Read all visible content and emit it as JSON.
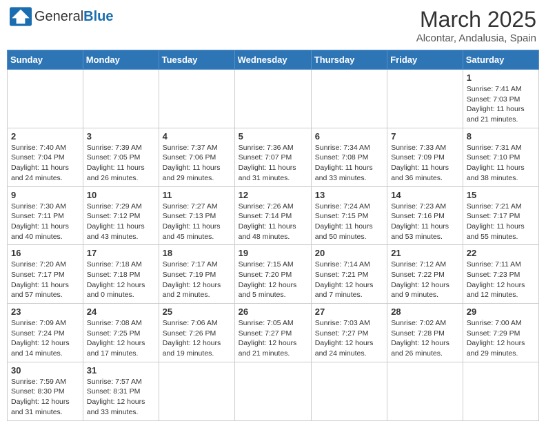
{
  "header": {
    "logo_text_normal": "General",
    "logo_text_bold": "Blue",
    "month_title": "March 2025",
    "subtitle": "Alcontar, Andalusia, Spain"
  },
  "weekdays": [
    "Sunday",
    "Monday",
    "Tuesday",
    "Wednesday",
    "Thursday",
    "Friday",
    "Saturday"
  ],
  "days": {
    "d1": {
      "num": "1",
      "info": "Sunrise: 7:41 AM\nSunset: 7:03 PM\nDaylight: 11 hours\nand 21 minutes."
    },
    "d2": {
      "num": "2",
      "info": "Sunrise: 7:40 AM\nSunset: 7:04 PM\nDaylight: 11 hours\nand 24 minutes."
    },
    "d3": {
      "num": "3",
      "info": "Sunrise: 7:39 AM\nSunset: 7:05 PM\nDaylight: 11 hours\nand 26 minutes."
    },
    "d4": {
      "num": "4",
      "info": "Sunrise: 7:37 AM\nSunset: 7:06 PM\nDaylight: 11 hours\nand 29 minutes."
    },
    "d5": {
      "num": "5",
      "info": "Sunrise: 7:36 AM\nSunset: 7:07 PM\nDaylight: 11 hours\nand 31 minutes."
    },
    "d6": {
      "num": "6",
      "info": "Sunrise: 7:34 AM\nSunset: 7:08 PM\nDaylight: 11 hours\nand 33 minutes."
    },
    "d7": {
      "num": "7",
      "info": "Sunrise: 7:33 AM\nSunset: 7:09 PM\nDaylight: 11 hours\nand 36 minutes."
    },
    "d8": {
      "num": "8",
      "info": "Sunrise: 7:31 AM\nSunset: 7:10 PM\nDaylight: 11 hours\nand 38 minutes."
    },
    "d9": {
      "num": "9",
      "info": "Sunrise: 7:30 AM\nSunset: 7:11 PM\nDaylight: 11 hours\nand 40 minutes."
    },
    "d10": {
      "num": "10",
      "info": "Sunrise: 7:29 AM\nSunset: 7:12 PM\nDaylight: 11 hours\nand 43 minutes."
    },
    "d11": {
      "num": "11",
      "info": "Sunrise: 7:27 AM\nSunset: 7:13 PM\nDaylight: 11 hours\nand 45 minutes."
    },
    "d12": {
      "num": "12",
      "info": "Sunrise: 7:26 AM\nSunset: 7:14 PM\nDaylight: 11 hours\nand 48 minutes."
    },
    "d13": {
      "num": "13",
      "info": "Sunrise: 7:24 AM\nSunset: 7:15 PM\nDaylight: 11 hours\nand 50 minutes."
    },
    "d14": {
      "num": "14",
      "info": "Sunrise: 7:23 AM\nSunset: 7:16 PM\nDaylight: 11 hours\nand 53 minutes."
    },
    "d15": {
      "num": "15",
      "info": "Sunrise: 7:21 AM\nSunset: 7:17 PM\nDaylight: 11 hours\nand 55 minutes."
    },
    "d16": {
      "num": "16",
      "info": "Sunrise: 7:20 AM\nSunset: 7:17 PM\nDaylight: 11 hours\nand 57 minutes."
    },
    "d17": {
      "num": "17",
      "info": "Sunrise: 7:18 AM\nSunset: 7:18 PM\nDaylight: 12 hours\nand 0 minutes."
    },
    "d18": {
      "num": "18",
      "info": "Sunrise: 7:17 AM\nSunset: 7:19 PM\nDaylight: 12 hours\nand 2 minutes."
    },
    "d19": {
      "num": "19",
      "info": "Sunrise: 7:15 AM\nSunset: 7:20 PM\nDaylight: 12 hours\nand 5 minutes."
    },
    "d20": {
      "num": "20",
      "info": "Sunrise: 7:14 AM\nSunset: 7:21 PM\nDaylight: 12 hours\nand 7 minutes."
    },
    "d21": {
      "num": "21",
      "info": "Sunrise: 7:12 AM\nSunset: 7:22 PM\nDaylight: 12 hours\nand 9 minutes."
    },
    "d22": {
      "num": "22",
      "info": "Sunrise: 7:11 AM\nSunset: 7:23 PM\nDaylight: 12 hours\nand 12 minutes."
    },
    "d23": {
      "num": "23",
      "info": "Sunrise: 7:09 AM\nSunset: 7:24 PM\nDaylight: 12 hours\nand 14 minutes."
    },
    "d24": {
      "num": "24",
      "info": "Sunrise: 7:08 AM\nSunset: 7:25 PM\nDaylight: 12 hours\nand 17 minutes."
    },
    "d25": {
      "num": "25",
      "info": "Sunrise: 7:06 AM\nSunset: 7:26 PM\nDaylight: 12 hours\nand 19 minutes."
    },
    "d26": {
      "num": "26",
      "info": "Sunrise: 7:05 AM\nSunset: 7:27 PM\nDaylight: 12 hours\nand 21 minutes."
    },
    "d27": {
      "num": "27",
      "info": "Sunrise: 7:03 AM\nSunset: 7:27 PM\nDaylight: 12 hours\nand 24 minutes."
    },
    "d28": {
      "num": "28",
      "info": "Sunrise: 7:02 AM\nSunset: 7:28 PM\nDaylight: 12 hours\nand 26 minutes."
    },
    "d29": {
      "num": "29",
      "info": "Sunrise: 7:00 AM\nSunset: 7:29 PM\nDaylight: 12 hours\nand 29 minutes."
    },
    "d30": {
      "num": "30",
      "info": "Sunrise: 7:59 AM\nSunset: 8:30 PM\nDaylight: 12 hours\nand 31 minutes."
    },
    "d31": {
      "num": "31",
      "info": "Sunrise: 7:57 AM\nSunset: 8:31 PM\nDaylight: 12 hours\nand 33 minutes."
    }
  }
}
